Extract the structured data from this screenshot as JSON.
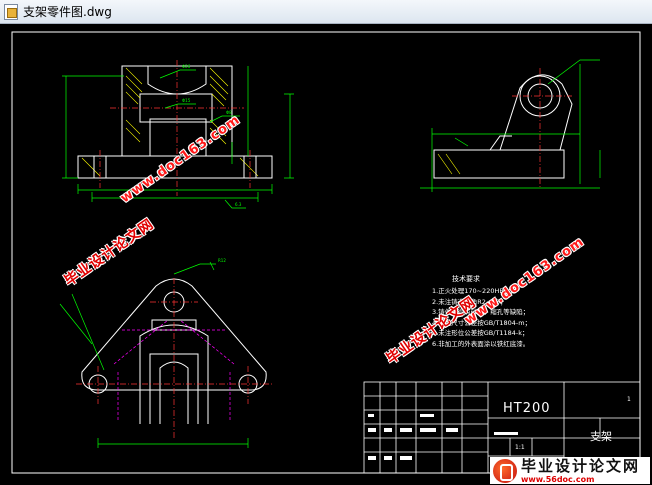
{
  "window": {
    "title": "支架零件图.dwg",
    "file_icon": "dwg-file-icon"
  },
  "drawing": {
    "notes_title": "技术要求",
    "notes": [
      "1.正火处理170~220HBW；",
      "2.未注铸造圆角R2~R3；",
      "3.铸件不得有砂眼、缩孔等缺陷；",
      "4.未注尺寸公差按GB/T1804-m；",
      "5.未注形位公差按GB/T1184-k；",
      "6.非加工的外表面涂以铁红底漆。"
    ],
    "title_block": {
      "material": "HT200",
      "part_name": "支架",
      "scale": "1:1",
      "sheet": "1"
    }
  },
  "watermarks": {
    "url": "www.doc163.com",
    "cn": "毕业设计论文网"
  },
  "logo": {
    "cn": "毕业设计论文网",
    "url": "www.56doc.com"
  },
  "colors": {
    "canvas": "#000000",
    "geometry": "#ffffff",
    "dimension": "#00ff00",
    "centerline": "#ff3333",
    "hatch": "#ffff00",
    "hidden": "#ff00ff",
    "frame": "#ffffff"
  }
}
